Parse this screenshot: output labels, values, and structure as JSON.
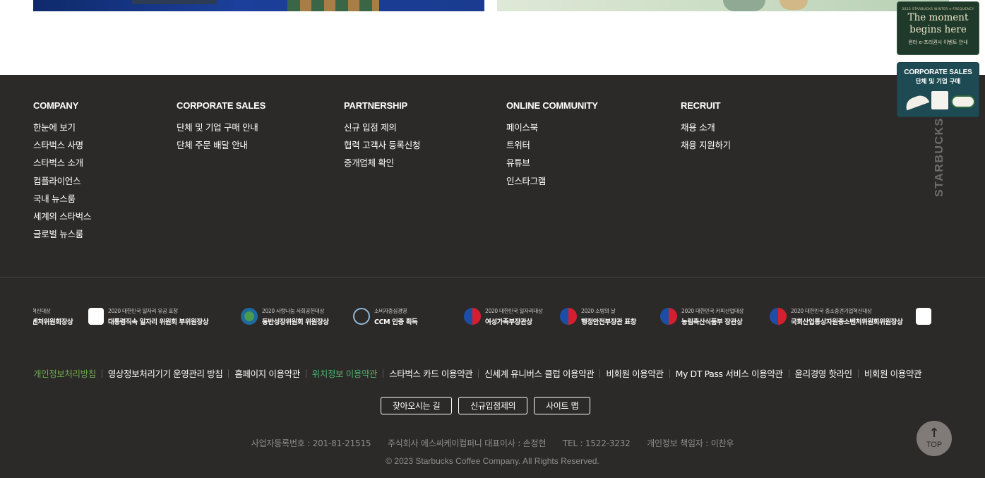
{
  "footer_menu": [
    {
      "title": "COMPANY",
      "items": [
        "한눈에 보기",
        "스타벅스 사명",
        "스타벅스 소개",
        "컴플라이언스",
        "국내 뉴스룸",
        "세계의 스타벅스",
        "글로벌 뉴스룸"
      ]
    },
    {
      "title": "CORPORATE SALES",
      "items": [
        "단체 및 기업 구매 안내",
        "단체 주문 배달 안내"
      ]
    },
    {
      "title": "PARTNERSHIP",
      "items": [
        "신규 입점 제의",
        "협력 고객사 등록신청",
        "중개업체 확인"
      ]
    },
    {
      "title": "ONLINE COMMUNITY",
      "items": [
        "페이스북",
        "트위터",
        "유튜브",
        "인스타그램"
      ]
    },
    {
      "title": "RECRUIT",
      "items": [
        "채용 소개",
        "채용 지원하기"
      ]
    }
  ],
  "brand_vertical": "STARBUCKS",
  "awards": [
    {
      "small": "혁신대상",
      "big": "벤처위원회장상",
      "icon": "emblem-icon"
    },
    {
      "small": "2020 대한민국 일자리 유공 표창",
      "big": "대통령직속 일자리 위원회 부위원장상",
      "icon": "job-committee-icon"
    },
    {
      "small": "2020 사랑나눔 사회공헌대상",
      "big": "동반성장위원회 위원장상",
      "icon": "shared-growth-icon"
    },
    {
      "small": "소비자중심경영",
      "big": "CCM 인증 획득",
      "icon": "ccm-icon"
    },
    {
      "small": "2020 대한민국 일자리대상",
      "big": "여성가족부장관상",
      "icon": "taeguk-icon"
    },
    {
      "small": "2020 소방의 날",
      "big": "행정안전부장관 표창",
      "icon": "taeguk-icon"
    },
    {
      "small": "2020 대한민국 커피산업대상",
      "big": "농림축산식품부 장관상",
      "icon": "taeguk-icon"
    },
    {
      "small": "2020 대한민국 중소중견기업혁신대상",
      "big": "국회산업통상자원중소벤처위원회위원장상",
      "icon": "taeguk-icon"
    },
    {
      "small": "",
      "big": "",
      "icon": "job-committee-icon"
    }
  ],
  "policy_links": [
    {
      "label": "개인정보처리방침",
      "style": "green"
    },
    {
      "label": "영상정보처리기기 운영관리 방침",
      "style": "normal"
    },
    {
      "label": "홈페이지 이용약관",
      "style": "normal"
    },
    {
      "label": "위치정보 이용약관",
      "style": "hl"
    },
    {
      "label": "스타벅스 카드 이용약관",
      "style": "normal"
    },
    {
      "label": "신세계 유니버스 클럽 이용약관",
      "style": "normal"
    },
    {
      "label": "비회원 이용약관",
      "style": "normal"
    },
    {
      "label": "My DT Pass 서비스 이용약관",
      "style": "normal"
    },
    {
      "label": "윤리경영 핫라인",
      "style": "normal"
    },
    {
      "label": "비회원 이용약관",
      "style": "normal"
    }
  ],
  "buttons": {
    "directions": "찾아오시는 길",
    "new_store": "신규입점제의",
    "sitemap": "사이트 맵"
  },
  "info": {
    "business_no": "사업자등록번호 : 201-81-21515",
    "company": "주식회사 에스씨케이컴퍼니 대표이사 : 손정현",
    "tel": "TEL : 1522-3232",
    "privacy_officer": "개인정보 책임자 : 이찬우"
  },
  "copyright": "© 2023 Starbucks Coffee Company. All Rights Reserved.",
  "top_button": {
    "label": "TOP",
    "icon": "arrow-up-icon"
  },
  "side_banners": {
    "winter": {
      "small": "2023 STARBUCKS WINTER e-FREQUENCY",
      "title_line1": "The moment",
      "title_line2": "begins here",
      "sub": "윈터 e-프리퀀시 이벤트 안내"
    },
    "corporate": {
      "title": "CORPORATE SALES",
      "sub": "단체 및 기업 구매"
    }
  },
  "colors": {
    "footer_bg": "#2c2a29",
    "green_link": "#6caa4e",
    "highlight_link": "#4fb36c"
  }
}
